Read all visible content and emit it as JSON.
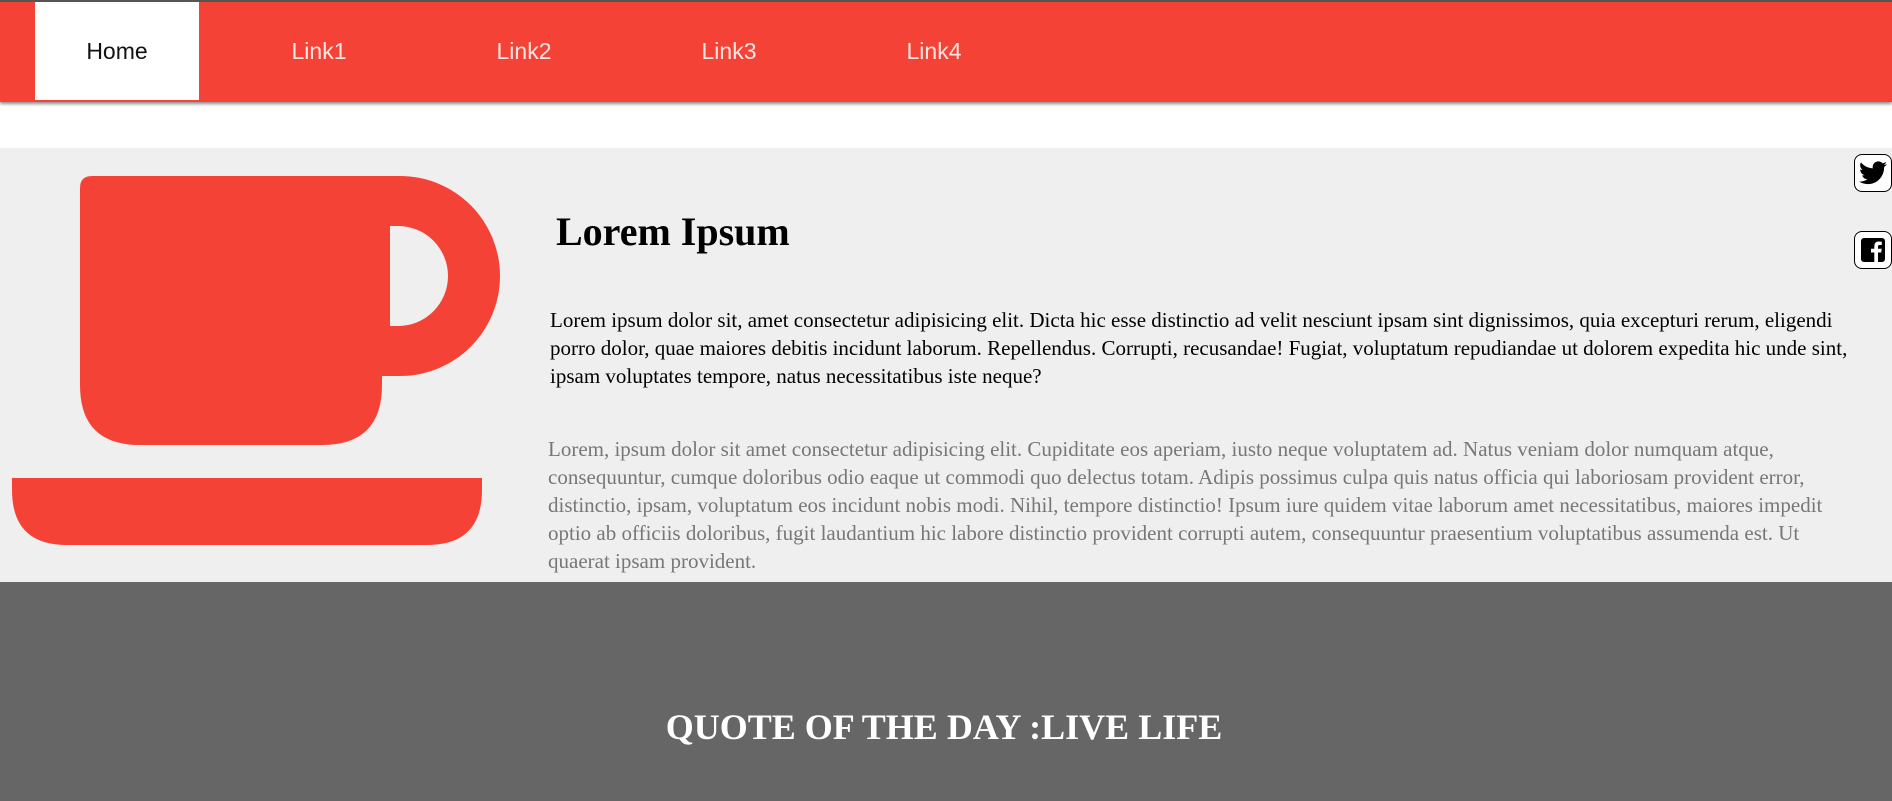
{
  "nav": {
    "items": [
      {
        "label": "Home",
        "active": true
      },
      {
        "label": "Link1",
        "active": false
      },
      {
        "label": "Link2",
        "active": false
      },
      {
        "label": "Link3",
        "active": false
      },
      {
        "label": "Link4",
        "active": false
      }
    ]
  },
  "hero": {
    "icon": "coffee-cup-icon",
    "title": "Lorem Ipsum",
    "paragraph1": "Lorem ipsum dolor sit, amet consectetur adipisicing elit. Dicta hic esse distinctio ad velit nesciunt ipsam sint dignissimos, quia excepturi rerum, eligendi porro dolor, quae maiores debitis incidunt laborum. Repellendus. Corrupti, recusandae! Fugiat, voluptatum repudiandae ut dolorem expedita hic unde sint, ipsam voluptates tempore, natus necessitatibus iste neque?",
    "paragraph2": "Lorem, ipsum dolor sit amet consectetur adipisicing elit. Cupiditate eos aperiam, iusto neque voluptatem ad. Natus veniam dolor numquam atque, consequuntur, cumque doloribus odio eaque ut commodi quo delectus totam. Adipis possimus culpa quis natus officia qui laboriosam provident error, distinctio, ipsam, voluptatum eos incidunt nobis modi. Nihil, tempore distinctio! Ipsum iure quidem vitae laborum amet necessitatibus, maiores impedit optio ab officiis doloribus, fugit laudantium hic labore distinctio provident corrupti autem, consequuntur praesentium voluptatibus assumenda est. Ut quaerat ipsam provident."
  },
  "social": [
    {
      "icon": "twitter-icon"
    },
    {
      "icon": "facebook-icon"
    }
  ],
  "footer": {
    "quote": "QUOTE OF THE DAY :LIVE LIFE"
  },
  "colors": {
    "accent": "#f44336",
    "content_bg": "#efefef",
    "footer_bg": "#666666",
    "muted_text": "#777777"
  }
}
